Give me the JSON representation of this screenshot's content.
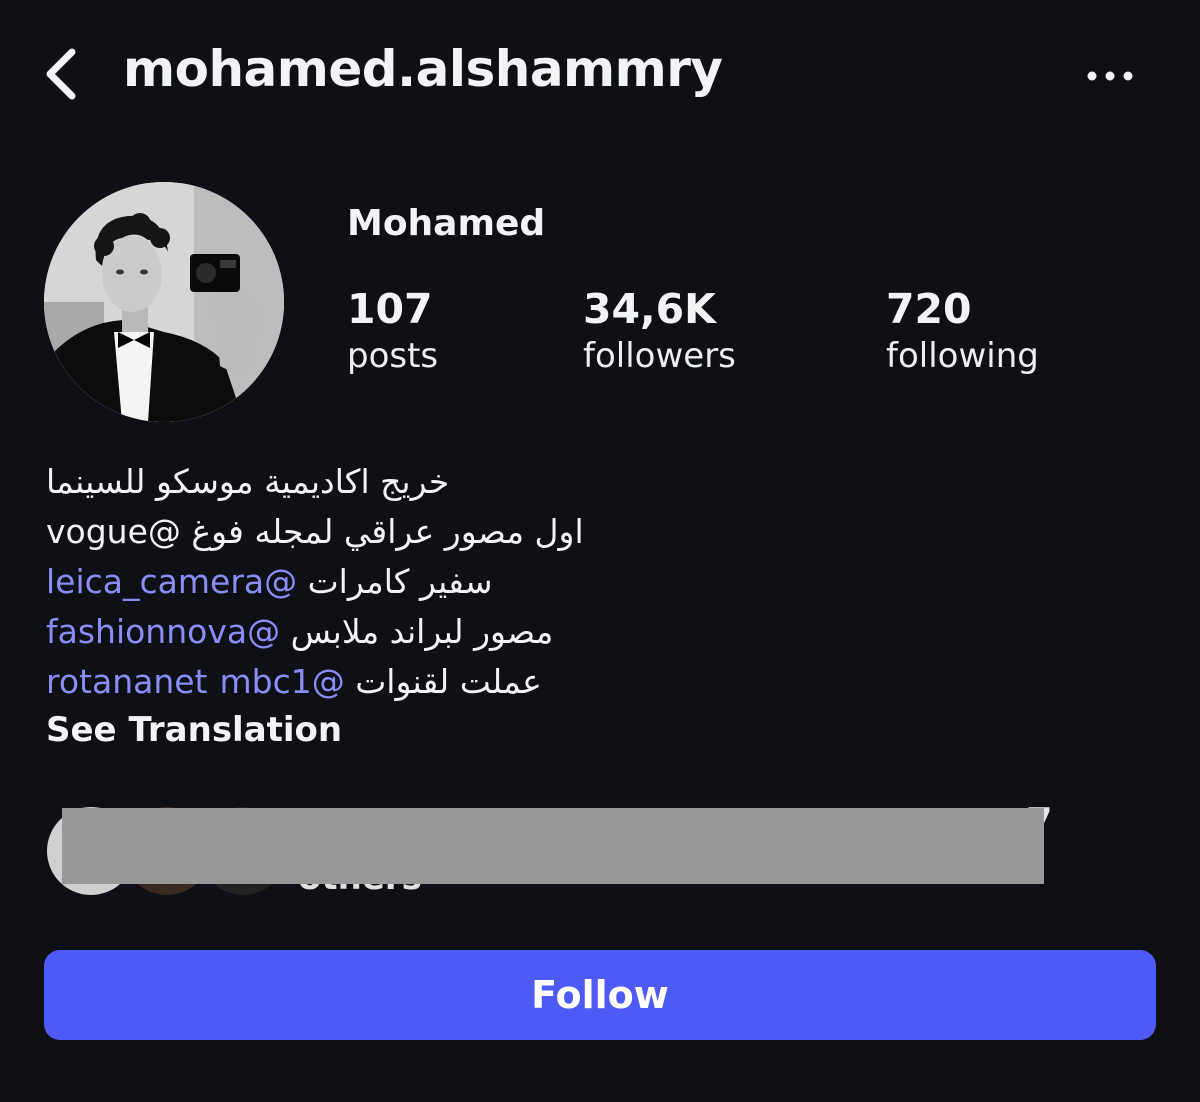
{
  "header": {
    "back_icon": "chevron-left-icon",
    "username": "mohamed.alshammry",
    "more_icon": "more-horizontal-icon"
  },
  "profile": {
    "display_name": "Mohamed",
    "avatar_description": "black-and-white mirror selfie with camera",
    "stats": {
      "posts": {
        "value": "107",
        "label": "posts"
      },
      "followers": {
        "value": "34,6K",
        "label": "followers"
      },
      "following": {
        "value": "720",
        "label": "following"
      }
    }
  },
  "bio": {
    "line1": "خريج اكاديمية موسكو للسينما",
    "line2_text": "اول مصور عراقي لمجله فوغ ",
    "line2_mention": "@vogue",
    "line3_text": "سفير كامرات ",
    "line3_mention": "@leica_camera",
    "line4_text": "مصور لبراند ملابس ",
    "line4_mention": "@fashionnova",
    "line5_text": "عملت لقنوات  ",
    "line5_mention_a": "@rotananet",
    "line5_mention_b": "mbc1",
    "see_translation": "See Translation"
  },
  "followed_by": {
    "redacted": true,
    "visible_suffix_top": "7",
    "visible_suffix_bottom": "others"
  },
  "actions": {
    "follow_label": "Follow"
  },
  "colors": {
    "background": "#0e1015",
    "mention": "#8b8df7",
    "follow_button": "#4e5af5",
    "redaction": "#989898"
  }
}
